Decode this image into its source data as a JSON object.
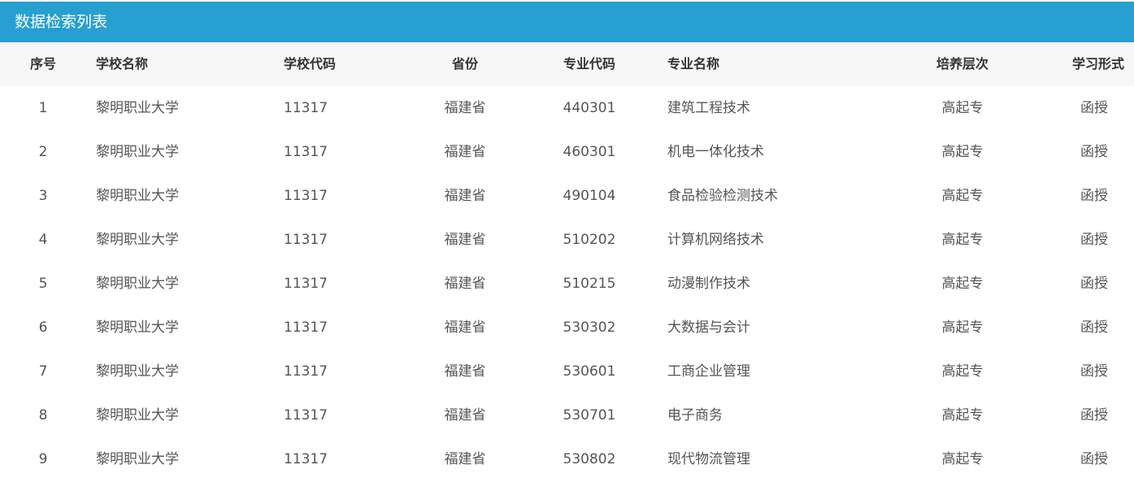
{
  "panel": {
    "title": "数据检索列表"
  },
  "columns": [
    "序号",
    "学校名称",
    "学校代码",
    "省份",
    "专业代码",
    "专业名称",
    "培养层次",
    "学习形式"
  ],
  "rows": [
    [
      "1",
      "黎明职业大学",
      "11317",
      "福建省",
      "440301",
      "建筑工程技术",
      "高起专",
      "函授"
    ],
    [
      "2",
      "黎明职业大学",
      "11317",
      "福建省",
      "460301",
      "机电一体化技术",
      "高起专",
      "函授"
    ],
    [
      "3",
      "黎明职业大学",
      "11317",
      "福建省",
      "490104",
      "食品检验检测技术",
      "高起专",
      "函授"
    ],
    [
      "4",
      "黎明职业大学",
      "11317",
      "福建省",
      "510202",
      "计算机网络技术",
      "高起专",
      "函授"
    ],
    [
      "5",
      "黎明职业大学",
      "11317",
      "福建省",
      "510215",
      "动漫制作技术",
      "高起专",
      "函授"
    ],
    [
      "6",
      "黎明职业大学",
      "11317",
      "福建省",
      "530302",
      "大数据与会计",
      "高起专",
      "函授"
    ],
    [
      "7",
      "黎明职业大学",
      "11317",
      "福建省",
      "530601",
      "工商企业管理",
      "高起专",
      "函授"
    ],
    [
      "8",
      "黎明职业大学",
      "11317",
      "福建省",
      "530701",
      "电子商务",
      "高起专",
      "函授"
    ],
    [
      "9",
      "黎明职业大学",
      "11317",
      "福建省",
      "530802",
      "现代物流管理",
      "高起专",
      "函授"
    ]
  ],
  "colors": {
    "title_bar": "#279fd1",
    "header_row": "#f7f7f7"
  }
}
